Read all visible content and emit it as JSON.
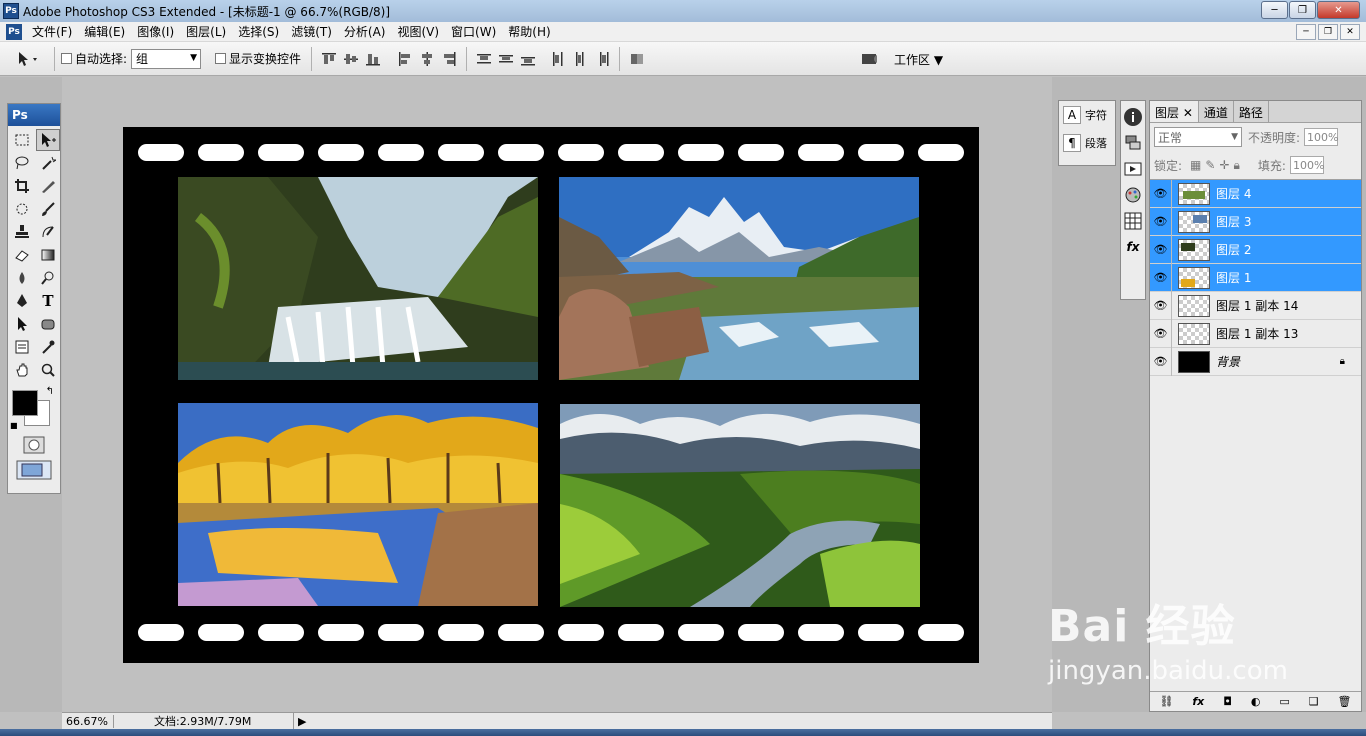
{
  "window": {
    "title": "Adobe Photoshop CS3 Extended - [未标题-1 @ 66.7%(RGB/8)]",
    "ps_logo": "Ps"
  },
  "menu": [
    "文件(F)",
    "编辑(E)",
    "图像(I)",
    "图层(L)",
    "选择(S)",
    "滤镜(T)",
    "分析(A)",
    "视图(V)",
    "窗口(W)",
    "帮助(H)"
  ],
  "options": {
    "auto_select_label": "自动选择:",
    "auto_select_value": "组",
    "show_transform_label": "显示变换控件",
    "workspace_label": "工作区"
  },
  "toolbox": {
    "header": "Ps"
  },
  "mini_panel": {
    "char_label": "字符",
    "para_label": "段落"
  },
  "layers_panel": {
    "tabs": [
      "图层",
      "通道",
      "路径"
    ],
    "blend_mode": "正常",
    "opacity_label": "不透明度:",
    "opacity_value": "100%",
    "lock_label": "锁定:",
    "fill_label": "填充:",
    "fill_value": "100%",
    "layers": [
      {
        "name": "图层 4",
        "selected": true
      },
      {
        "name": "图层 3",
        "selected": true
      },
      {
        "name": "图层 2",
        "selected": true
      },
      {
        "name": "图层 1",
        "selected": true
      },
      {
        "name": "图层 1 副本 14",
        "selected": false
      },
      {
        "name": "图层 1 副本 13",
        "selected": false
      },
      {
        "name": "背景",
        "selected": false
      }
    ]
  },
  "status": {
    "zoom": "66.67%",
    "doc_info": "文档:2.93M/7.79M"
  },
  "watermark": {
    "line1": "Bai 经验",
    "line2": "jingyan.baidu.com"
  }
}
